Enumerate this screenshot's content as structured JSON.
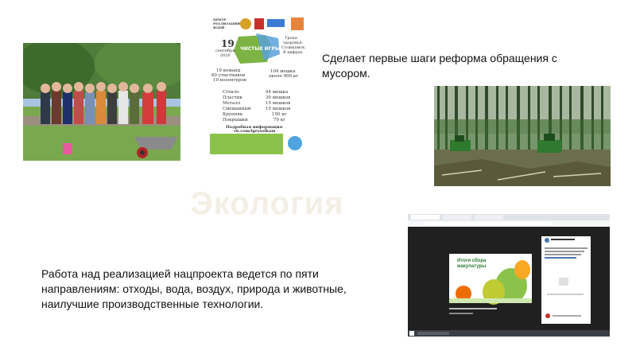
{
  "slide": {
    "title": "Экология",
    "caption_top": "Сделает первые шаги реформа обращения с мусором.",
    "caption_bottom": "Работа над реализацией нацпроекта ведется по пяти направлениям: отходы, вода, воздух, природа и животные, наилучшие производственные технологии."
  },
  "poster": {
    "date_day": "19",
    "date_month": "сентября",
    "date_year": "2020",
    "badge": "ЧИСТЫЕ ИГРЫ",
    "slogan": [
      "Тропа",
      "здоровья.",
      "Соликамск.",
      "В цифрах"
    ],
    "stats_left": [
      "16 команд",
      "60 участников",
      "10 волонтеров"
    ],
    "stats_right": [
      "104 мешка",
      "около 900 кг"
    ],
    "materials": [
      {
        "name": "Стекло",
        "value": "44 мешка"
      },
      {
        "name": "Пластик",
        "value": "30 мешков"
      },
      {
        "name": "Металл",
        "value": "15 мешков"
      },
      {
        "name": "Смешанный",
        "value": "15 мешков"
      },
      {
        "name": "Крупняк",
        "value": "150 кг"
      },
      {
        "name": "Покрышки",
        "value": "70 кг"
      }
    ],
    "info_label": "Подробная информация",
    "info_link": "vk.com/igrysolkam"
  },
  "browser": {
    "card_title": "Итоги сбора макулатуры"
  },
  "colors": {
    "title": "#f3efe6",
    "text": "#111111",
    "poster_green": "#7cb342",
    "card_green": "#8bc34a"
  }
}
